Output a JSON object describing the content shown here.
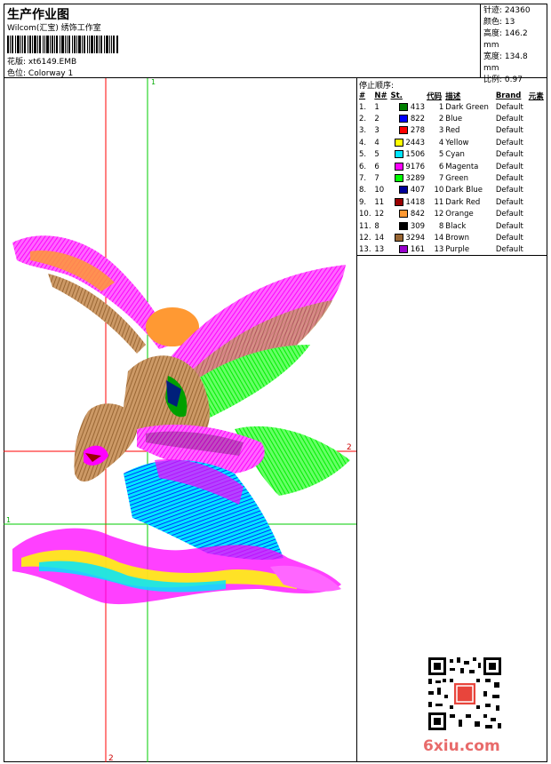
{
  "header": {
    "title": "生产作业图",
    "company": "Wilcom(汇宝) 绣饰工作室",
    "pattern_label": "花版:",
    "pattern_value": "xt6149.EMB",
    "colorway_label": "色位:",
    "colorway_value": "Colorway 1"
  },
  "info": {
    "stitches_label": "针迹:",
    "stitches_value": "24360",
    "colors_label": "颜色:",
    "colors_value": "13",
    "height_label": "高度:",
    "height_value": "146.2 mm",
    "width_label": "宽度:",
    "width_value": "134.8 mm",
    "scale_label": "比例:",
    "scale_value": "0.97"
  },
  "stop_sequence": {
    "title": "停止顺序:",
    "headers": [
      "#",
      "N#",
      "St.",
      "代码",
      "描述",
      "Brand",
      "元素"
    ],
    "rows": [
      {
        "idx": "1.",
        "n": "1",
        "st": "413",
        "code": "1",
        "desc": "Dark Green",
        "brand": "Default",
        "color": "#008000"
      },
      {
        "idx": "2.",
        "n": "2",
        "st": "822",
        "code": "2",
        "desc": "Blue",
        "brand": "Default",
        "color": "#0000ff"
      },
      {
        "idx": "3.",
        "n": "3",
        "st": "278",
        "code": "3",
        "desc": "Red",
        "brand": "Default",
        "color": "#ff0000"
      },
      {
        "idx": "4.",
        "n": "4",
        "st": "2443",
        "code": "4",
        "desc": "Yellow",
        "brand": "Default",
        "color": "#ffff00"
      },
      {
        "idx": "5.",
        "n": "5",
        "st": "1506",
        "code": "5",
        "desc": "Cyan",
        "brand": "Default",
        "color": "#00e5ff"
      },
      {
        "idx": "6.",
        "n": "6",
        "st": "9176",
        "code": "6",
        "desc": "Magenta",
        "brand": "Default",
        "color": "#ff00ff"
      },
      {
        "idx": "7.",
        "n": "7",
        "st": "3289",
        "code": "7",
        "desc": "Green",
        "brand": "Default",
        "color": "#00ff00"
      },
      {
        "idx": "8.",
        "n": "10",
        "st": "407",
        "code": "10",
        "desc": "Dark Blue",
        "brand": "Default",
        "color": "#000099"
      },
      {
        "idx": "9.",
        "n": "11",
        "st": "1418",
        "code": "11",
        "desc": "Dark Red",
        "brand": "Default",
        "color": "#990000"
      },
      {
        "idx": "10.",
        "n": "12",
        "st": "842",
        "code": "12",
        "desc": "Orange",
        "brand": "Default",
        "color": "#ff9933"
      },
      {
        "idx": "11.",
        "n": "8",
        "st": "309",
        "code": "8",
        "desc": "Black",
        "brand": "Default",
        "color": "#000000"
      },
      {
        "idx": "12.",
        "n": "14",
        "st": "3294",
        "code": "14",
        "desc": "Brown",
        "brand": "Default",
        "color": "#996633"
      },
      {
        "idx": "13.",
        "n": "13",
        "st": "161",
        "code": "13",
        "desc": "Purple",
        "brand": "Default",
        "color": "#9900cc"
      }
    ]
  },
  "design": {
    "guide_top_label": "1",
    "guide_right_label": "2",
    "guide_left_label": "1",
    "guide_bottom_label": "2"
  },
  "watermark": {
    "site": "6xiu.com"
  }
}
